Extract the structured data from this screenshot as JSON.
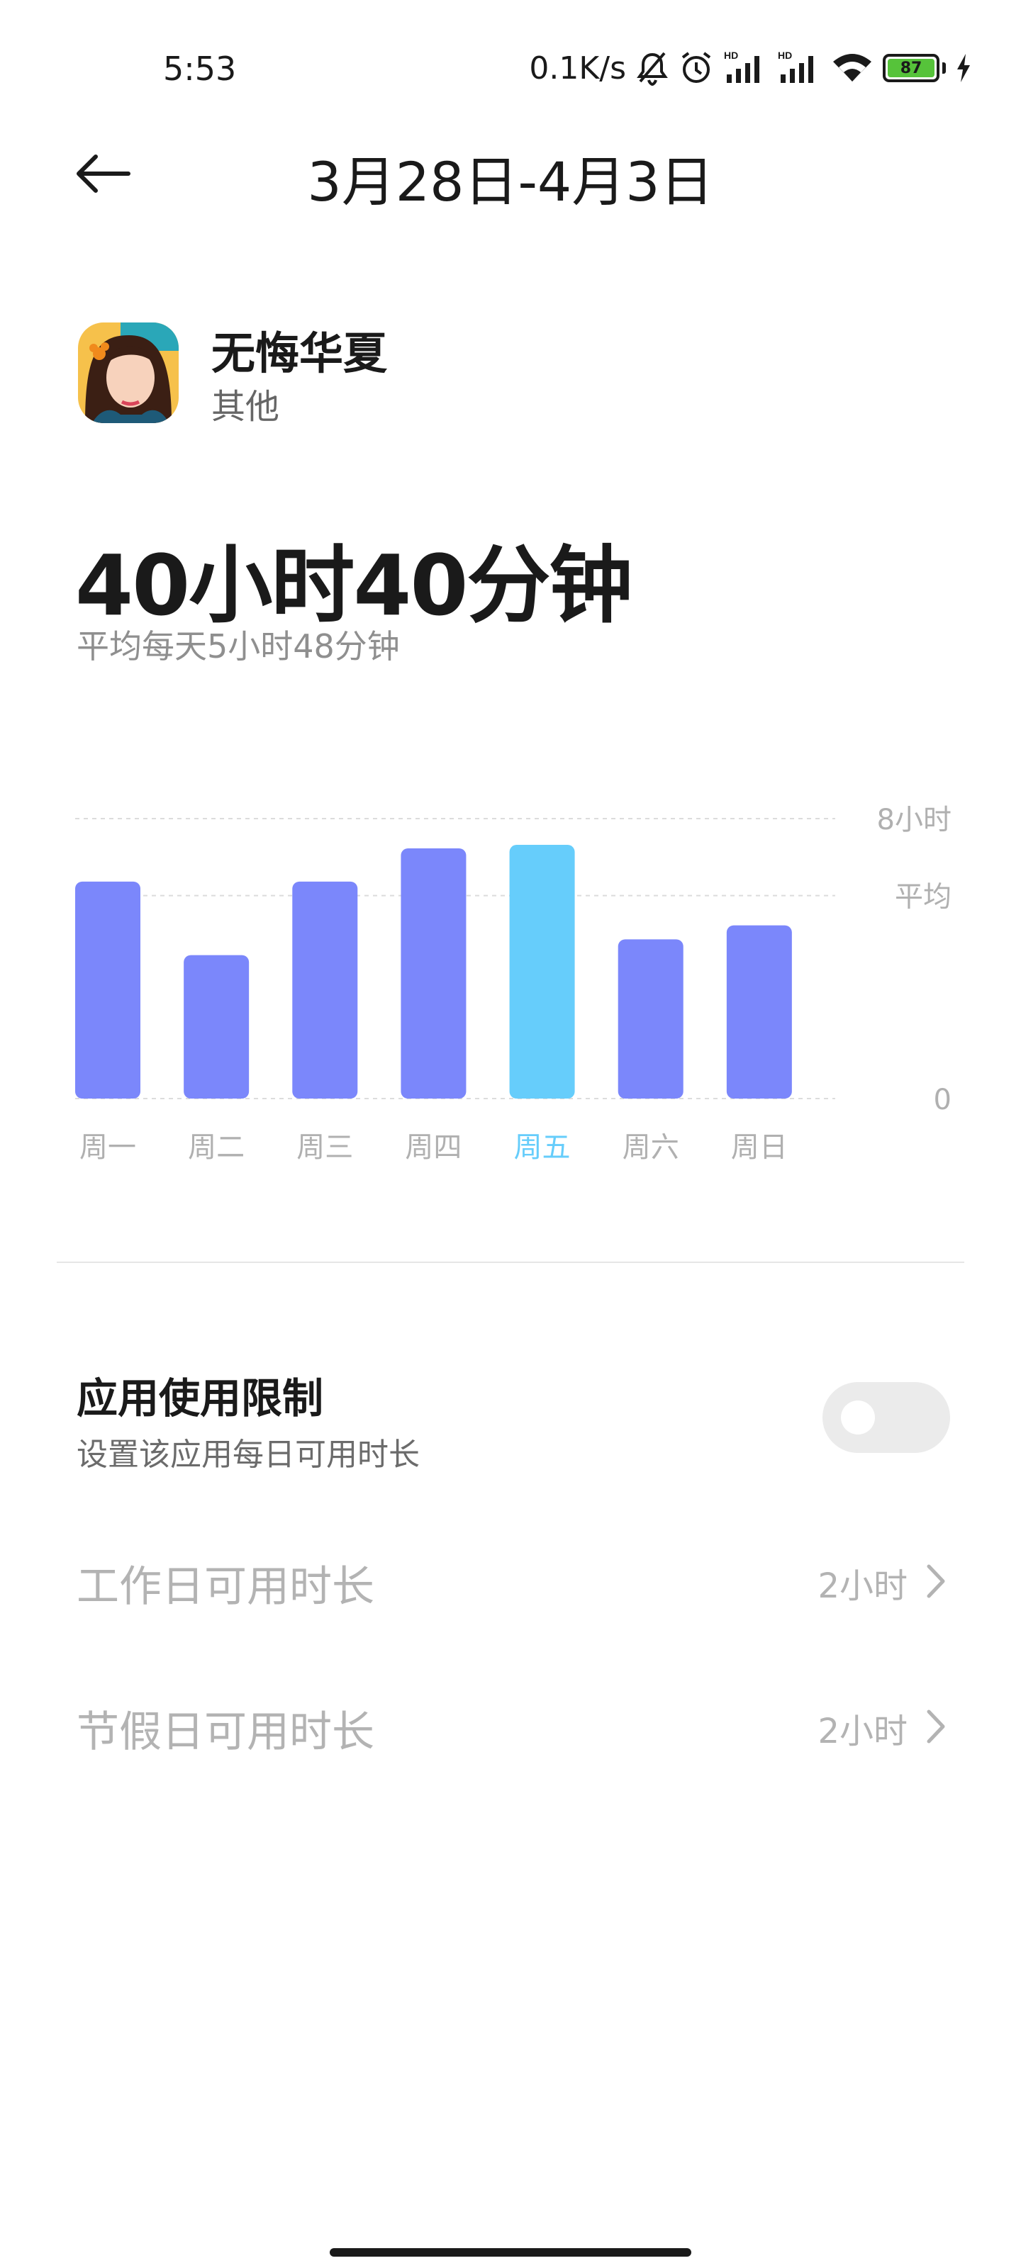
{
  "status_bar": {
    "time": "5:53",
    "net_speed": "0.1K/s",
    "battery_level": "87",
    "icons": [
      "bell-off-icon",
      "alarm-icon",
      "signal-hd-icon",
      "signal-hd-icon",
      "wifi-icon",
      "battery-icon",
      "charging-icon"
    ]
  },
  "header": {
    "title": "3月28日-4月3日",
    "back_icon": "arrow-left-icon"
  },
  "app": {
    "name": "无悔华夏",
    "category": "其他"
  },
  "usage": {
    "total": "40小时40分钟",
    "average": "平均每天5小时48分钟"
  },
  "chart_data": {
    "type": "bar",
    "categories": [
      "周一",
      "周二",
      "周三",
      "周四",
      "周五",
      "周六",
      "周日"
    ],
    "values": [
      6.2,
      4.1,
      6.2,
      7.15,
      7.25,
      4.55,
      4.95
    ],
    "highlight_index": 4,
    "average": 5.8,
    "ylim": [
      0,
      8
    ],
    "y_tick_labels": {
      "top": "8小时",
      "avg": "平均",
      "zero": "0"
    },
    "colors": {
      "bar": "#7b87fb",
      "highlight": "#66cdfb",
      "grid": "#dcdcdc",
      "label": "#b0b0b0"
    }
  },
  "limits": {
    "title": "应用使用限制",
    "subtitle": "设置该应用每日可用时长",
    "enabled": false,
    "rows": [
      {
        "label": "工作日可用时长",
        "value": "2小时"
      },
      {
        "label": "节假日可用时长",
        "value": "2小时"
      }
    ]
  }
}
